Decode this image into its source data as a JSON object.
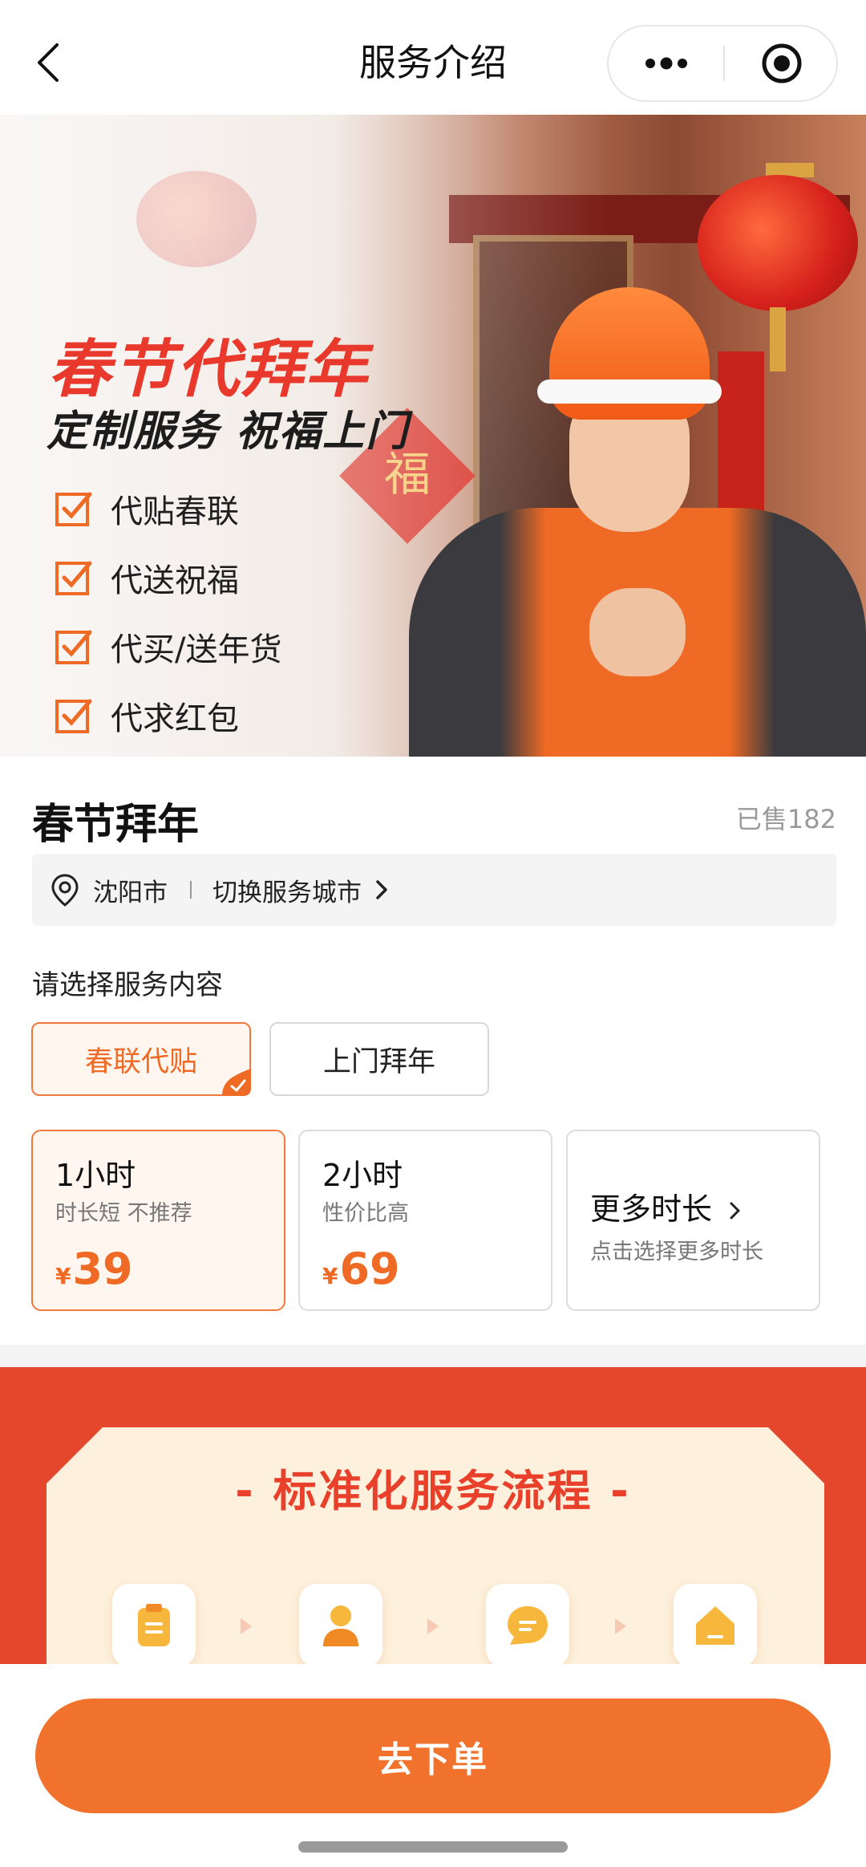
{
  "navbar": {
    "title": "服务介绍"
  },
  "banner": {
    "title": "春节代拜年",
    "subtitle": "定制服务 祝福上门",
    "items": [
      "代贴春联",
      "代送祝福",
      "代买/送年货",
      "代求红包"
    ],
    "door_sign": "福"
  },
  "product": {
    "title": "春节拜年",
    "sold": "已售182"
  },
  "city": {
    "name": "沈阳市",
    "switch_label": "切换服务城市"
  },
  "service": {
    "label": "请选择服务内容",
    "types": [
      {
        "label": "春联代贴",
        "selected": true
      },
      {
        "label": "上门拜年",
        "selected": false
      }
    ]
  },
  "durations": [
    {
      "title": "1小时",
      "desc": "时长短 不推荐",
      "currency": "¥",
      "price": "39",
      "selected": true
    },
    {
      "title": "2小时",
      "desc": "性价比高",
      "currency": "¥",
      "price": "69",
      "selected": false
    }
  ],
  "more_duration": {
    "title": "更多时长",
    "desc": "点击选择更多时长"
  },
  "process": {
    "title": "- 标准化服务流程 -",
    "steps": [
      "clipboard-icon",
      "person-icon",
      "chat-icon",
      "house-icon"
    ]
  },
  "bottom": {
    "order_label": "去下单"
  },
  "colors": {
    "accent": "#ef6a24",
    "process_bg": "#e5472c",
    "promo_red": "#e8392c"
  }
}
